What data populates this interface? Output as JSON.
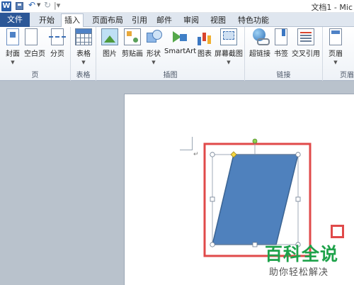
{
  "window": {
    "title": "文档1 - Mic"
  },
  "quick_access": {
    "app_icon": "W"
  },
  "tabs": [
    {
      "label": "文件"
    },
    {
      "label": "开始"
    },
    {
      "label": "插入"
    },
    {
      "label": "页面布局"
    },
    {
      "label": "引用"
    },
    {
      "label": "邮件"
    },
    {
      "label": "审阅"
    },
    {
      "label": "视图"
    },
    {
      "label": "特色功能"
    }
  ],
  "ribbon": {
    "groups": [
      {
        "label": "页",
        "buttons": [
          "封面",
          "空白页",
          "分页"
        ]
      },
      {
        "label": "表格",
        "buttons": [
          "表格"
        ]
      },
      {
        "label": "插图",
        "buttons": [
          "图片",
          "剪贴画",
          "形状",
          "SmartArt",
          "图表",
          "屏幕截图"
        ]
      },
      {
        "label": "链接",
        "buttons": [
          "超链接",
          "书签",
          "交叉引用"
        ]
      },
      {
        "label": "页眉",
        "buttons": [
          "页眉"
        ]
      }
    ]
  },
  "document": {
    "paragraph_mark": "↵",
    "shape": {
      "type": "parallelogram",
      "fill": "#4f81bd",
      "stroke": "#3a6392"
    },
    "highlight_color": "#e04a4a"
  },
  "watermark": {
    "title": "百科全说",
    "subtitle": "助你轻松解决"
  }
}
